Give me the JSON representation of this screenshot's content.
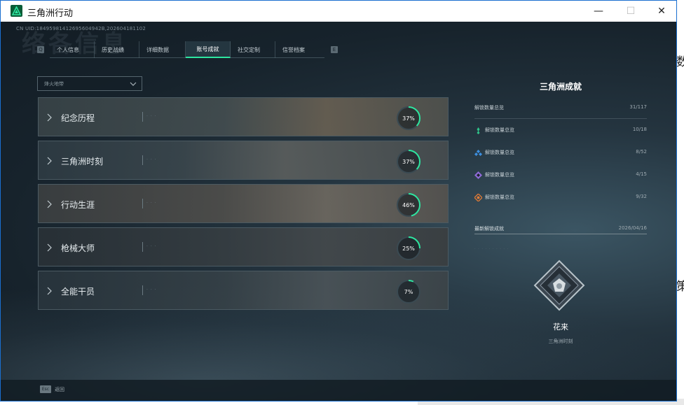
{
  "desktop": {
    "char_1": "数",
    "char_2": "策"
  },
  "window": {
    "title": "三角洲行动",
    "minimize": "—",
    "maximize": "☐",
    "close": "✕"
  },
  "header": {
    "uid": "CN UID:18495981412695604942B,202604181102",
    "bg_title": "络各信息"
  },
  "tabs": {
    "key_left": "Q",
    "key_right": "E",
    "items": [
      {
        "label": "个人信息"
      },
      {
        "label": "历史战绩"
      },
      {
        "label": "详细数据"
      },
      {
        "label": "账号成就"
      },
      {
        "label": "社交定制"
      },
      {
        "label": "信誉档案"
      }
    ],
    "active_index": 3
  },
  "filter": {
    "value": "烽火地带"
  },
  "categories": [
    {
      "name": "纪念历程",
      "progress": 37,
      "progress_label": "37%",
      "dots": "· · ·"
    },
    {
      "name": "三角洲时刻",
      "progress": 37,
      "progress_label": "37%",
      "dots": "· · ·"
    },
    {
      "name": "行动生涯",
      "progress": 46,
      "progress_label": "46%",
      "dots": "· · ·"
    },
    {
      "name": "枪械大师",
      "progress": 25,
      "progress_label": "25%",
      "dots": "· · ·"
    },
    {
      "name": "全能干员",
      "progress": 7,
      "progress_label": "7%",
      "dots": "· · ·"
    }
  ],
  "right_panel": {
    "title": "三角洲成就",
    "total": {
      "label": "解锁数量总览",
      "value": "31/117"
    },
    "tiers": [
      {
        "label": "解锁数量总览",
        "value": "10/18",
        "color": "#2fc38a",
        "icon": "green-tier-icon"
      },
      {
        "label": "解锁数量总览",
        "value": "8/52",
        "color": "#3c8fe0",
        "icon": "blue-tier-icon"
      },
      {
        "label": "解锁数量总览",
        "value": "4/15",
        "color": "#8f6ad8",
        "icon": "purple-tier-icon"
      },
      {
        "label": "解锁数量总览",
        "value": "9/32",
        "color": "#e07a36",
        "icon": "orange-tier-icon"
      }
    ],
    "latest": {
      "label": "最新解锁成就",
      "date": "2026/04/16",
      "dots": "· · · · · · · · · ·"
    },
    "badge": {
      "name": "花来",
      "category": "三角洲时刻"
    }
  },
  "footer": {
    "esc_key": "Esc",
    "esc_label": "返回"
  },
  "colors": {
    "accent": "#2ee6a0",
    "ring_track": "#3a4a52"
  }
}
